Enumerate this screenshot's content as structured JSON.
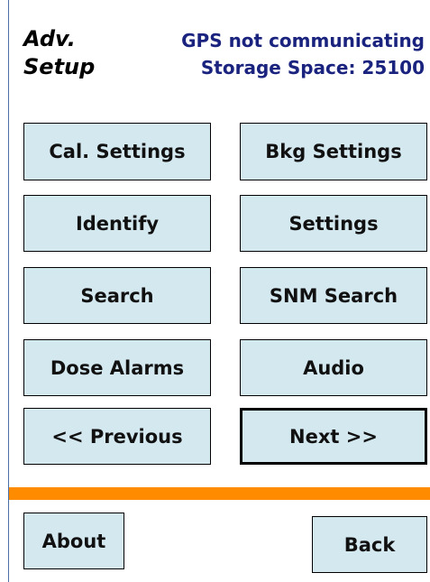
{
  "header": {
    "title_line1": "Adv.",
    "title_line2": "Setup",
    "gps_status": "GPS not communicating",
    "storage_space": "Storage Space: 25100"
  },
  "buttons": {
    "cal_settings": "Cal. Settings",
    "bkg_settings": "Bkg Settings",
    "identify": "Identify",
    "settings": "Settings",
    "search": "Search",
    "snm_search": "SNM Search",
    "dose_alarms": "Dose Alarms",
    "audio": "Audio",
    "previous": "<< Previous",
    "next": "Next >>"
  },
  "footer": {
    "about": "About",
    "back": "Back"
  },
  "colors": {
    "button_fill": "#d4e8f0",
    "accent_bar": "#ff8c00",
    "status_text": "#1a237e"
  }
}
